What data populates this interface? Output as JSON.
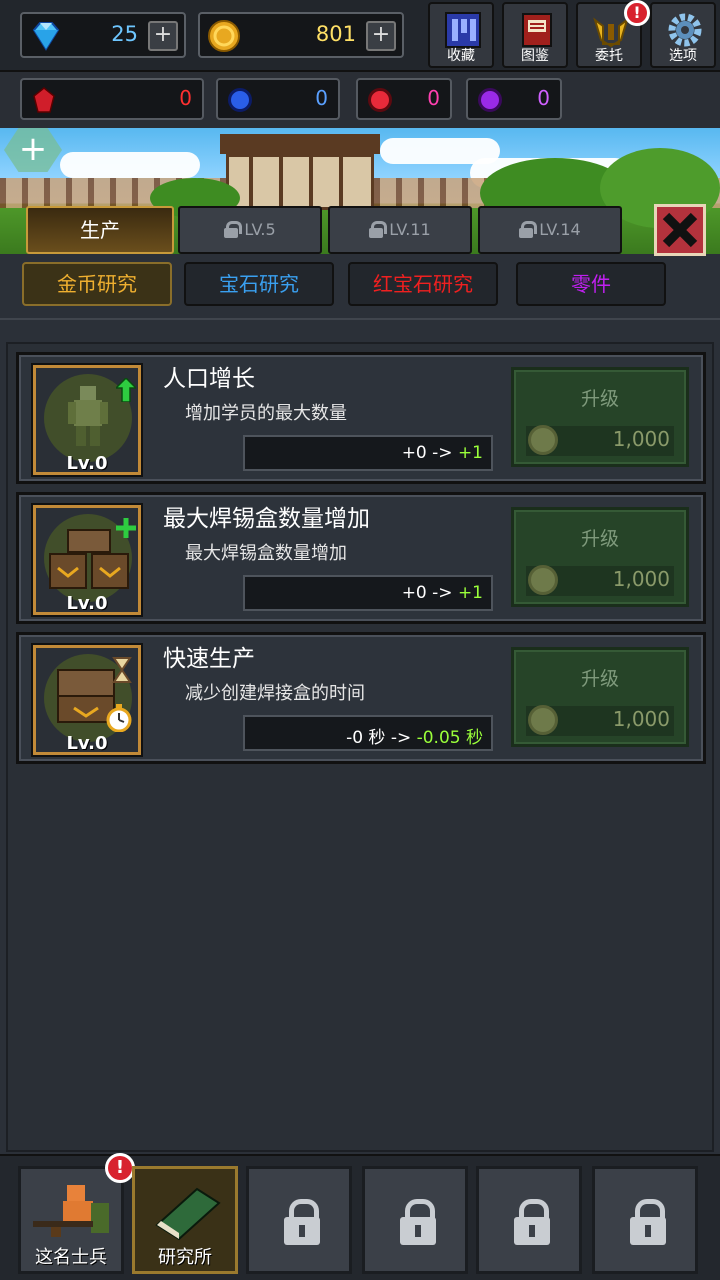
{
  "currency": {
    "diamonds": "25",
    "coins": "801"
  },
  "nav": {
    "collection": "收藏",
    "encyclopedia": "图鉴",
    "commission": "委托",
    "options": "选项"
  },
  "gems": {
    "red_crystal": "0",
    "blue": "0",
    "red": "0",
    "purple": "0"
  },
  "tabs": [
    {
      "label": "生产"
    },
    {
      "label": "LV.5"
    },
    {
      "label": "LV.11"
    },
    {
      "label": "LV.14"
    }
  ],
  "subtabs": [
    {
      "label": "金币研究",
      "color": "#f0b030"
    },
    {
      "label": "宝石研究",
      "color": "#3aa0f0"
    },
    {
      "label": "红宝石研究",
      "color": "#f02020"
    },
    {
      "label": "零件",
      "color": "#c020f0"
    }
  ],
  "research": [
    {
      "title": "人口增长",
      "desc": "增加学员的最大数量",
      "level": "Lv.0",
      "current": "+0 ->",
      "next": "+1",
      "upgrade_label": "升级",
      "cost": "1,000"
    },
    {
      "title": "最大焊锡盒数量增加",
      "desc": "最大焊锡盒数量增加",
      "level": "Lv.0",
      "current": "+0 ->",
      "next": "+1",
      "upgrade_label": "升级",
      "cost": "1,000"
    },
    {
      "title": "快速生产",
      "desc": "减少创建焊接盒的时间",
      "level": "Lv.0",
      "current": "-0 秒 ->",
      "next": "-0.05 秒",
      "upgrade_label": "升级",
      "cost": "1,000"
    }
  ],
  "bottom": {
    "soldier": "这名士兵",
    "lab": "研究所"
  },
  "alert_symbol": "!"
}
